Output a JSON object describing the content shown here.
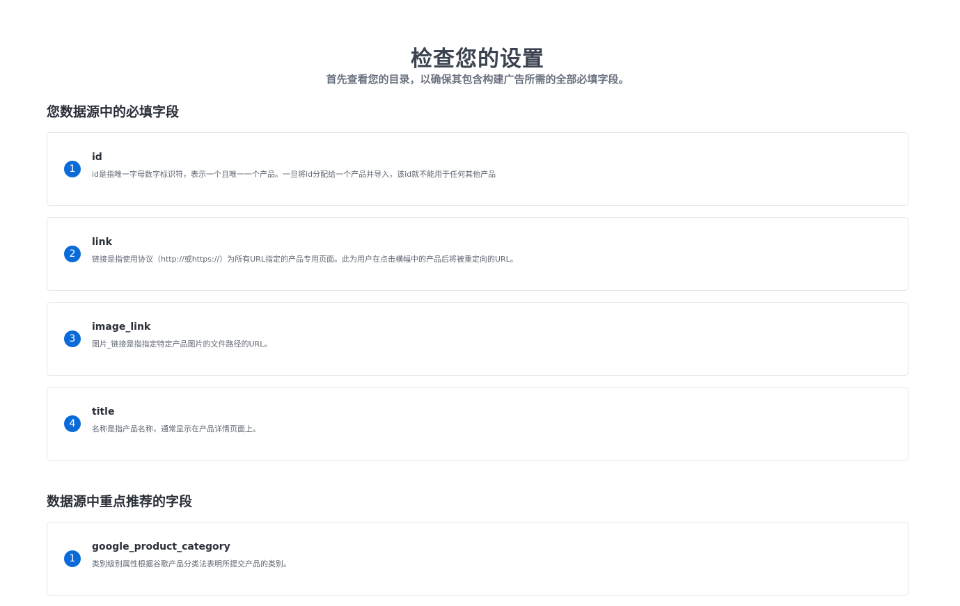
{
  "header": {
    "title": "检查您的设置",
    "subtitle": "首先查看您的目录，以确保其包含构建广告所需的全部必填字段。"
  },
  "required_section": {
    "title": "您数据源中的必填字段",
    "fields": [
      {
        "number": "1",
        "name": "id",
        "description": "id是指唯一字母数字标识符，表示一个且唯一一个产品。一旦将id分配给一个产品并导入，该id就不能用于任何其他产品"
      },
      {
        "number": "2",
        "name": "link",
        "description": "链接是指使用协议（http://或https://）为所有URL指定的产品专用页面。此为用户在点击横幅中的产品后将被重定向的URL。"
      },
      {
        "number": "3",
        "name": "image_link",
        "description": "图片_链接是指指定特定产品图片的文件路径的URL。"
      },
      {
        "number": "4",
        "name": "title",
        "description": "名称是指产品名称，通常显示在产品详情页面上。"
      }
    ]
  },
  "recommended_section": {
    "title": "数据源中重点推荐的字段",
    "fields": [
      {
        "number": "1",
        "name": "google_product_category",
        "description": "类别级别属性根据谷歌产品分类法表明所提交产品的类别。"
      }
    ]
  },
  "colors": {
    "badge": "#0a6bd8",
    "card_border": "#e3e6ea",
    "title": "#3b4250",
    "subtitle": "#6b7280"
  }
}
